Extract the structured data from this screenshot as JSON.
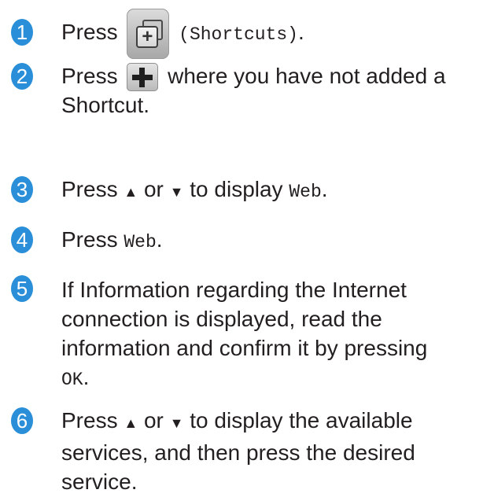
{
  "steps": [
    {
      "number": "1",
      "text_before": "Press",
      "icon": "shortcuts-icon",
      "code": "(Shortcuts)",
      "text_after": "."
    },
    {
      "number": "2",
      "text_before": "Press",
      "icon": "add-shortcut-plus-icon",
      "text_after": "where you have not added a",
      "text_line2": "Shortcut."
    },
    {
      "number": "3",
      "text_before": "Press",
      "up_arrow": "▲",
      "or": "or",
      "down_arrow": "▼",
      "text_mid": "to display",
      "code": "Web",
      "text_after": "."
    },
    {
      "number": "4",
      "text_before": "Press",
      "code": "Web",
      "text_after": "."
    },
    {
      "number": "5",
      "lines": [
        "If Information regarding the Internet",
        "connection is displayed, read the",
        "information and confirm it by pressing"
      ],
      "code": "OK",
      "text_after": "."
    },
    {
      "number": "6",
      "text_before": "Press",
      "up_arrow": "▲",
      "or": "or",
      "down_arrow": "▼",
      "text_mid": "to display the available",
      "lines": [
        "services, and then press the desired",
        "service."
      ]
    }
  ],
  "colors": {
    "badge": "#2a8fd8",
    "text": "#231f20"
  }
}
